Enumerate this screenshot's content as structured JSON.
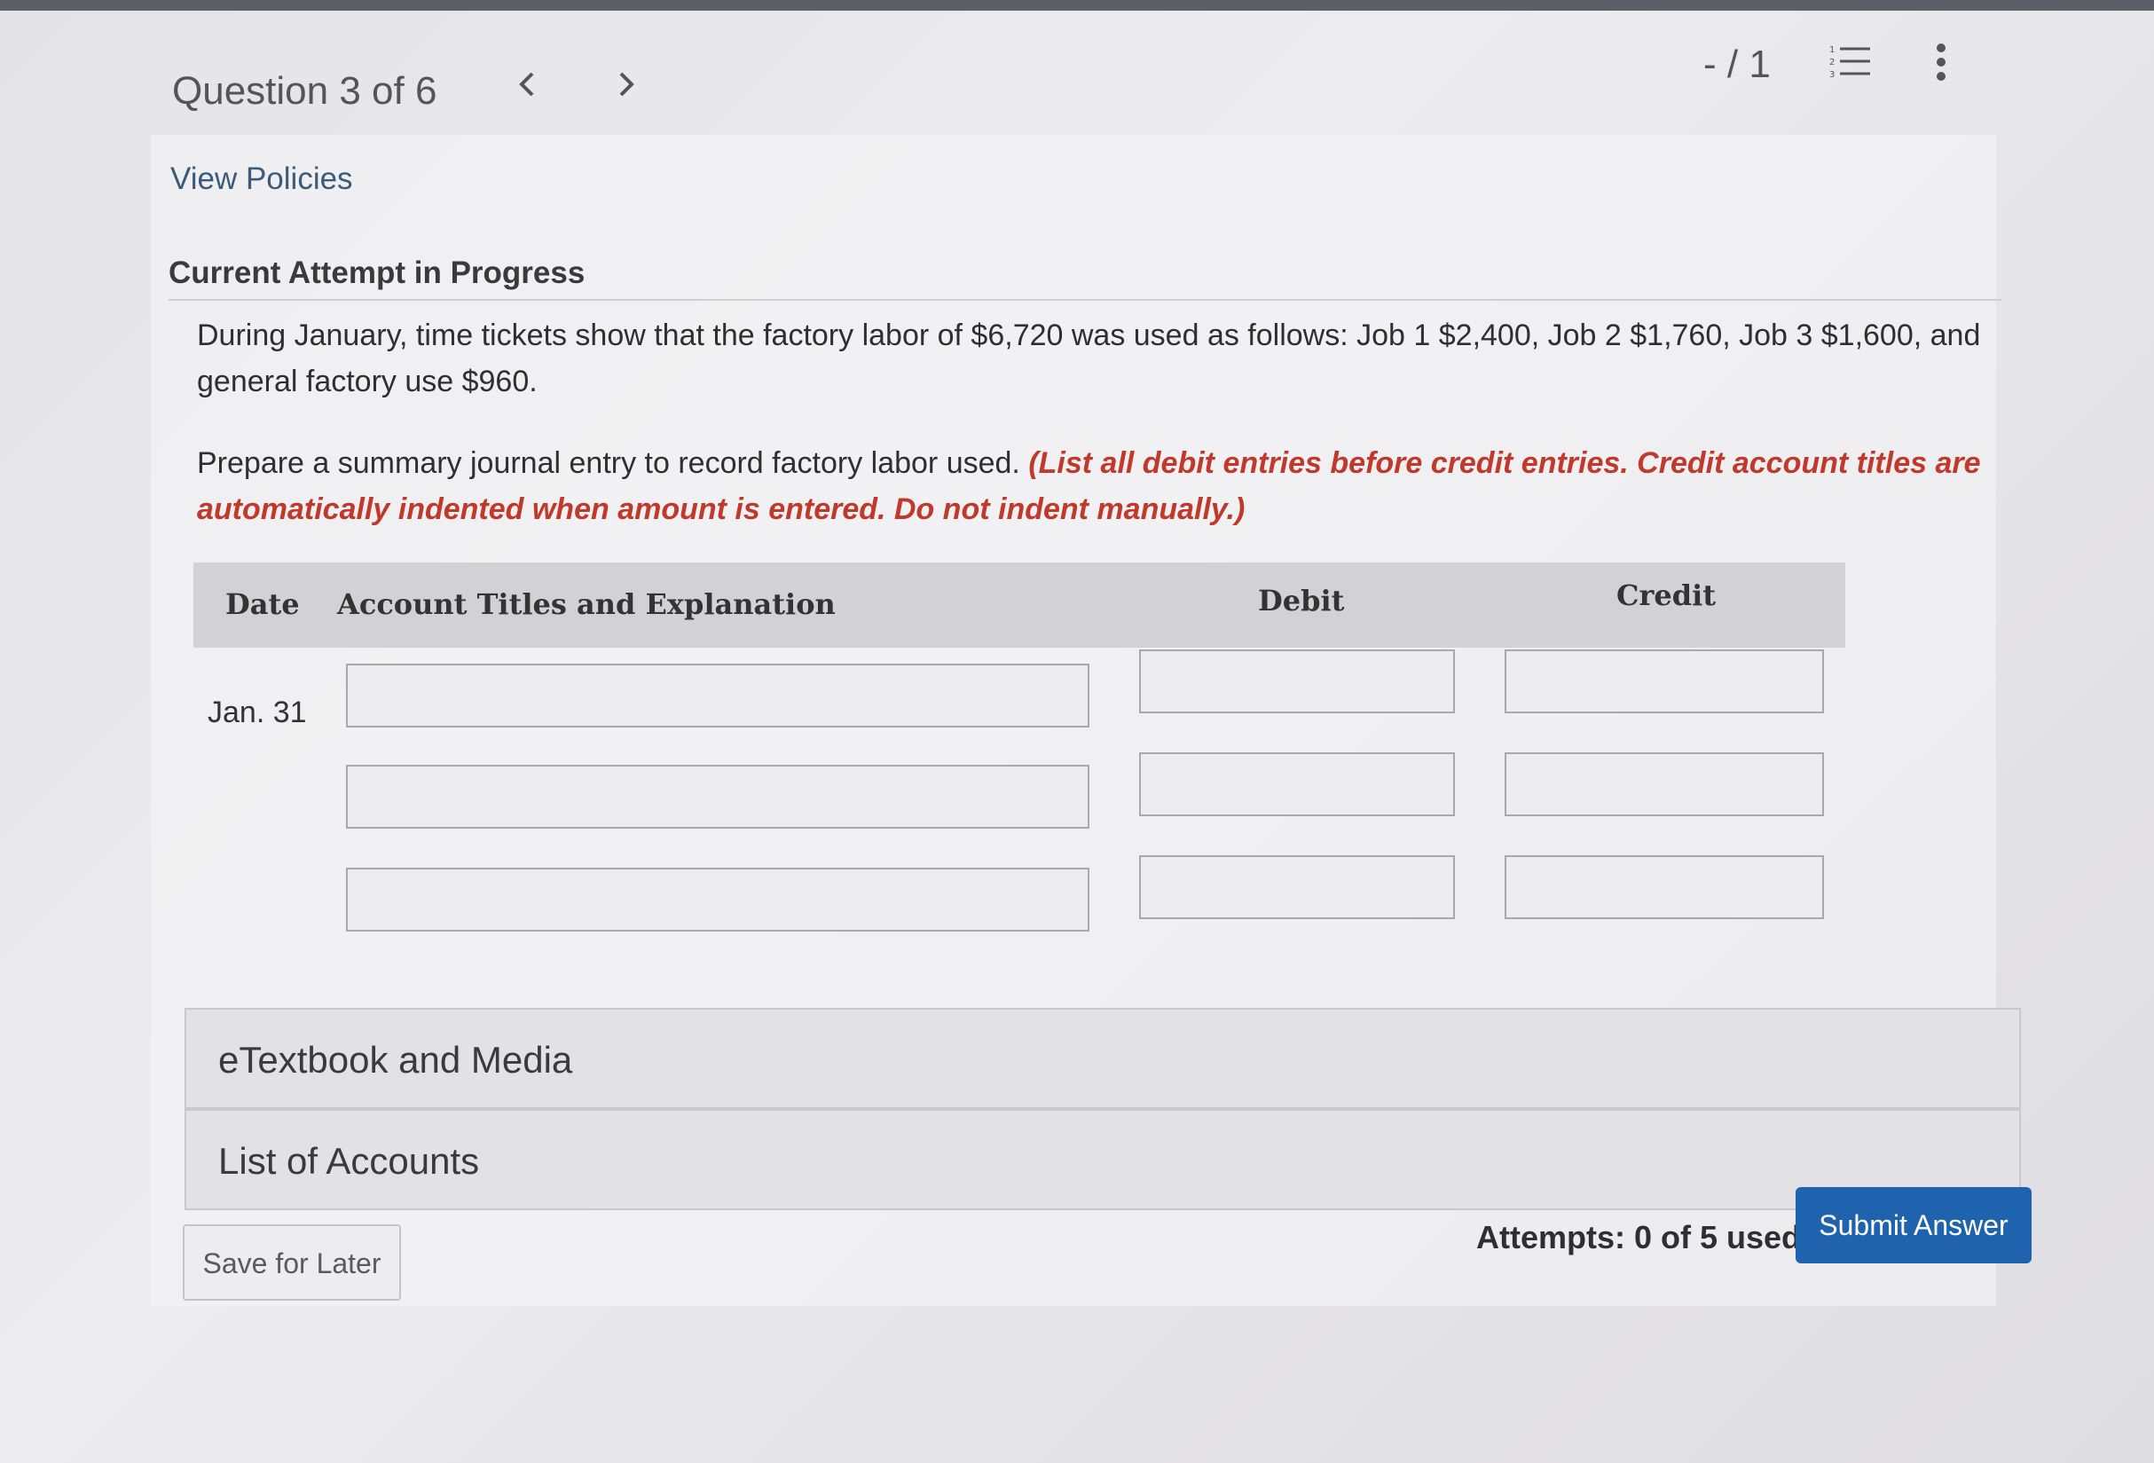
{
  "header": {
    "question_label": "Question 3 of 6",
    "prev_icon": "chevron-left-icon",
    "next_icon": "chevron-right-icon",
    "score": "- / 1",
    "list_icon": "numbered-list-icon",
    "more_icon": "more-vertical-icon"
  },
  "links": {
    "view_policies": "View Policies"
  },
  "attempt": {
    "heading": "Current Attempt in Progress"
  },
  "question": {
    "text": "During January, time tickets show that the factory labor of $6,720 was used as follows: Job 1 $2,400, Job 2 $1,760, Job 3 $1,600, and general factory use $960.",
    "prompt": "Prepare a summary journal entry to record factory labor used.",
    "instruction": "(List all debit entries before credit entries. Credit account titles are automatically indented when amount is entered. Do not indent manually.)"
  },
  "journal": {
    "headers": {
      "date": "Date",
      "account": "Account Titles and Explanation",
      "debit": "Debit",
      "credit": "Credit"
    },
    "date_value": "Jan. 31",
    "rows": [
      {
        "account": "",
        "debit": "",
        "credit": ""
      },
      {
        "account": "",
        "debit": "",
        "credit": ""
      },
      {
        "account": "",
        "debit": "",
        "credit": ""
      }
    ]
  },
  "sections": {
    "etextbook": "eTextbook and Media",
    "accounts": "List of Accounts"
  },
  "footer": {
    "save_label": "Save for Later",
    "attempts_text": "Attempts: 0 of 5 used",
    "submit_label": "Submit Answer"
  },
  "colors": {
    "instruction_red": "#c0392b",
    "submit_blue": "#1f62ad",
    "link_blue": "#3c5a7a"
  }
}
